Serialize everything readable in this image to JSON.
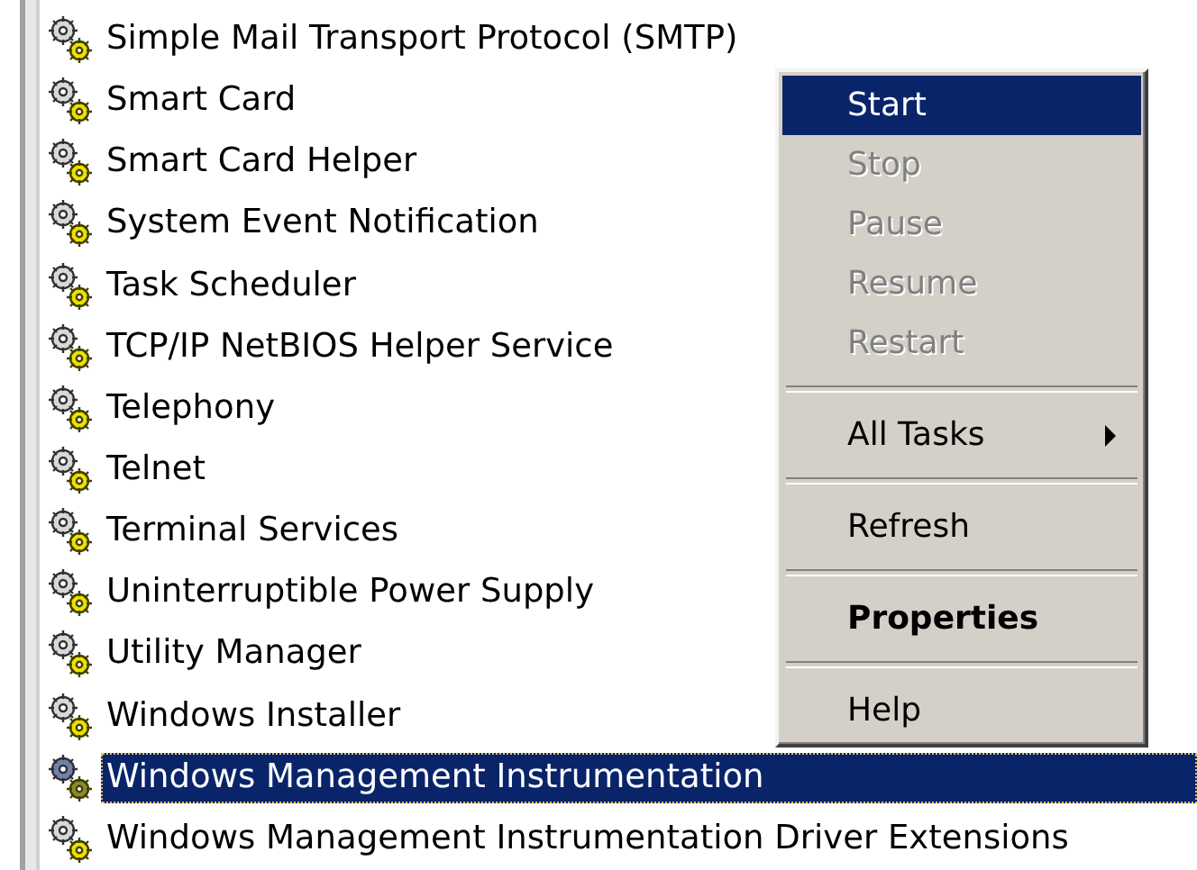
{
  "services": [
    {
      "name": "Simple Mail Transport Protocol (SMTP)",
      "selected": false
    },
    {
      "name": "Smart Card",
      "selected": false
    },
    {
      "name": "Smart Card Helper",
      "selected": false
    },
    {
      "name": "System Event Notification",
      "selected": false
    },
    {
      "name": "Task Scheduler",
      "selected": false
    },
    {
      "name": "TCP/IP NetBIOS Helper Service",
      "selected": false
    },
    {
      "name": "Telephony",
      "selected": false
    },
    {
      "name": "Telnet",
      "selected": false
    },
    {
      "name": "Terminal Services",
      "selected": false
    },
    {
      "name": "Uninterruptible Power Supply",
      "selected": false
    },
    {
      "name": "Utility Manager",
      "selected": false
    },
    {
      "name": "Windows Installer",
      "selected": false
    },
    {
      "name": "Windows Management Instrumentation",
      "selected": true
    },
    {
      "name": "Windows Management Instrumentation Driver Extensions",
      "selected": false
    }
  ],
  "context_menu": {
    "items": [
      {
        "kind": "item",
        "label": "Start",
        "disabled": false,
        "selected": true
      },
      {
        "kind": "item",
        "label": "Stop",
        "disabled": true,
        "selected": false
      },
      {
        "kind": "item",
        "label": "Pause",
        "disabled": true,
        "selected": false
      },
      {
        "kind": "item",
        "label": "Resume",
        "disabled": true,
        "selected": false
      },
      {
        "kind": "item",
        "label": "Restart",
        "disabled": true,
        "selected": false
      },
      {
        "kind": "separator"
      },
      {
        "kind": "submenu",
        "label": "All Tasks",
        "disabled": false,
        "selected": false
      },
      {
        "kind": "separator"
      },
      {
        "kind": "item",
        "label": "Refresh",
        "disabled": false,
        "selected": false
      },
      {
        "kind": "separator"
      },
      {
        "kind": "default",
        "label": "Properties",
        "disabled": false,
        "selected": false
      },
      {
        "kind": "separator"
      },
      {
        "kind": "item",
        "label": "Help",
        "disabled": false,
        "selected": false
      }
    ]
  }
}
